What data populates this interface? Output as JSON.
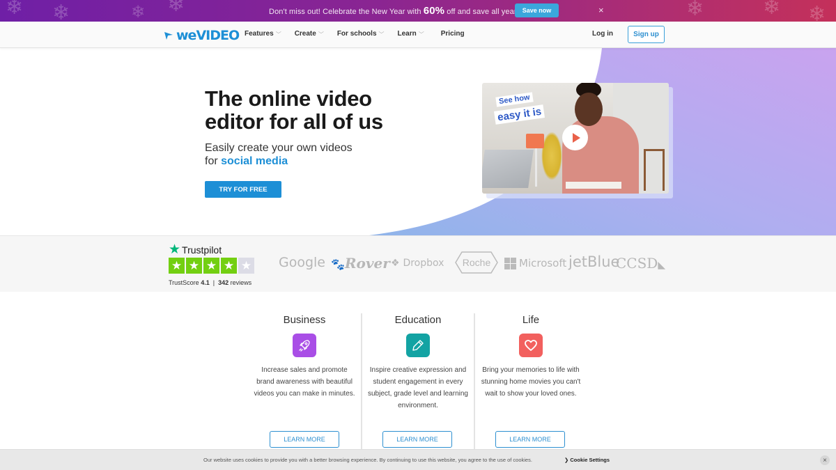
{
  "promo": {
    "text_before": "Don't miss out! Celebrate the New Year with ",
    "highlight": "60%",
    "text_after": " off and save all year long",
    "cta": "Save now",
    "close": "×"
  },
  "nav": {
    "logo": {
      "prefix": "we",
      "suffix": "video"
    },
    "items": [
      {
        "label": "Features",
        "has_dropdown": true
      },
      {
        "label": "Create",
        "has_dropdown": true
      },
      {
        "label": "For schools",
        "has_dropdown": true
      },
      {
        "label": "Learn",
        "has_dropdown": true
      },
      {
        "label": "Pricing",
        "has_dropdown": false
      }
    ],
    "login": "Log in",
    "signup": "Sign up"
  },
  "hero": {
    "title_line1": "The online video",
    "title_line2": "editor for all of us",
    "subtitle_line1": "Easily create your own videos",
    "subtitle_prefix": "for ",
    "subtitle_accent": "social media",
    "cta": "TRY FOR FREE",
    "video": {
      "tag_line1": "See how",
      "tag_line2": "easy it is"
    }
  },
  "trustpilot": {
    "brand": "Trustpilot",
    "rating": 4.1,
    "stars_filled": 4,
    "stars_total": 5,
    "score_label": "TrustScore",
    "score": "4.1",
    "separator": "|",
    "reviews_count": "342",
    "reviews_label": "reviews"
  },
  "brands": [
    "Google",
    "Rover",
    "Dropbox",
    "Roche",
    "Microsoft",
    "jetBlue",
    "CCSD"
  ],
  "categories": [
    {
      "title": "Business",
      "icon": "rocket-icon",
      "color": "#a94ee6",
      "desc": "Increase sales and promote brand awareness with beautiful videos you can make in minutes.",
      "cta": "LEARN MORE"
    },
    {
      "title": "Education",
      "icon": "pencil-icon",
      "color": "#13a3a3",
      "desc": "Inspire creative expression and student engagement in every subject, grade level and learning environment.",
      "cta": "LEARN MORE"
    },
    {
      "title": "Life",
      "icon": "heart-icon",
      "color": "#f2605e",
      "desc": "Bring your memories to life with stunning home movies you can't wait to show your loved ones.",
      "cta": "LEARN MORE"
    }
  ],
  "cookie": {
    "text": "Our website uses cookies to provide you with a better browsing experience. By continuing to use this website, you agree to the use of cookies.",
    "settings": "Cookie Settings",
    "close": "×"
  },
  "colors": {
    "accent": "#1d8fd6",
    "trustpilot_green": "#73cf11",
    "trustpilot_star": "#00b67a"
  }
}
